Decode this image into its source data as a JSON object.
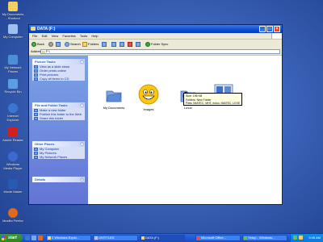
{
  "desktop": {
    "icons": [
      {
        "label": "My Documents - Shortcut",
        "icon": "documents-icon",
        "color": "#f0d060"
      },
      {
        "label": "My Computer",
        "icon": "computer-icon",
        "color": "#9cc0f0"
      },
      {
        "label": "My Network Places",
        "icon": "network-icon",
        "color": "#4a8fd8"
      },
      {
        "label": "Recycle Bin",
        "icon": "recycle-bin-icon",
        "color": "#5aa0e0"
      },
      {
        "label": "Internet Explorer",
        "icon": "ie-icon",
        "color": "#3a78d0"
      },
      {
        "label": "Adobe Reader",
        "icon": "adobe-reader-icon",
        "color": "#d02020"
      },
      {
        "label": "Windows Media Player",
        "icon": "media-player-icon",
        "color": "#3b6ad0"
      },
      {
        "label": "Movie Maker",
        "icon": "movie-maker-icon",
        "color": "#2a5ab0"
      },
      {
        "label": "Mozilla Firefox",
        "icon": "firefox-icon",
        "color": "#e06a1a"
      }
    ]
  },
  "window": {
    "title": "DATA (F:)",
    "menu": [
      "File",
      "Edit",
      "View",
      "Favorites",
      "Tools",
      "Help"
    ],
    "toolbar": {
      "back": "Back",
      "search": "Search",
      "folders": "Folders",
      "folder_sync": "Folder Sync"
    },
    "address": {
      "label": "Address",
      "value": "F:\\"
    },
    "taskpane": {
      "picture_tasks": {
        "title": "Picture Tasks",
        "items": [
          "View as a slide show",
          "Order prints online",
          "Print pictures",
          "Copy all items to CD"
        ]
      },
      "file_folder_tasks": {
        "title": "File and Folder Tasks",
        "items": [
          "Make a new folder",
          "Publish this folder to the Web",
          "Share this folder"
        ]
      },
      "other_places": {
        "title": "Other Places",
        "items": [
          "My Computer",
          "My Pictures",
          "My Network Places"
        ]
      },
      "details": {
        "title": "Details"
      }
    },
    "items": [
      {
        "label": "My Documents",
        "icon": "folder-icon"
      },
      {
        "label": "Images",
        "icon": "smiley-icon"
      },
      {
        "label": "Linux",
        "icon": "linux-folder-icon"
      },
      {
        "label": "",
        "icon": "windows-folder-icon"
      }
    ],
    "tooltip": {
      "line1": "Size: 195 KB",
      "line2": "Folders: New Folder",
      "line3": "Files: IMATEC, MHT, exico, IMATEC, LEXE, exe"
    }
  },
  "taskbar": {
    "start": "start",
    "tasks": [
      {
        "label": "2 Windows Explo..."
      },
      {
        "label": "UNTITLED"
      },
      {
        "label": "DATA (F:)"
      },
      {
        "label": "Microsoft Office..."
      },
      {
        "label": "Setup - Windows..."
      }
    ],
    "clock": "9:45 AM"
  }
}
